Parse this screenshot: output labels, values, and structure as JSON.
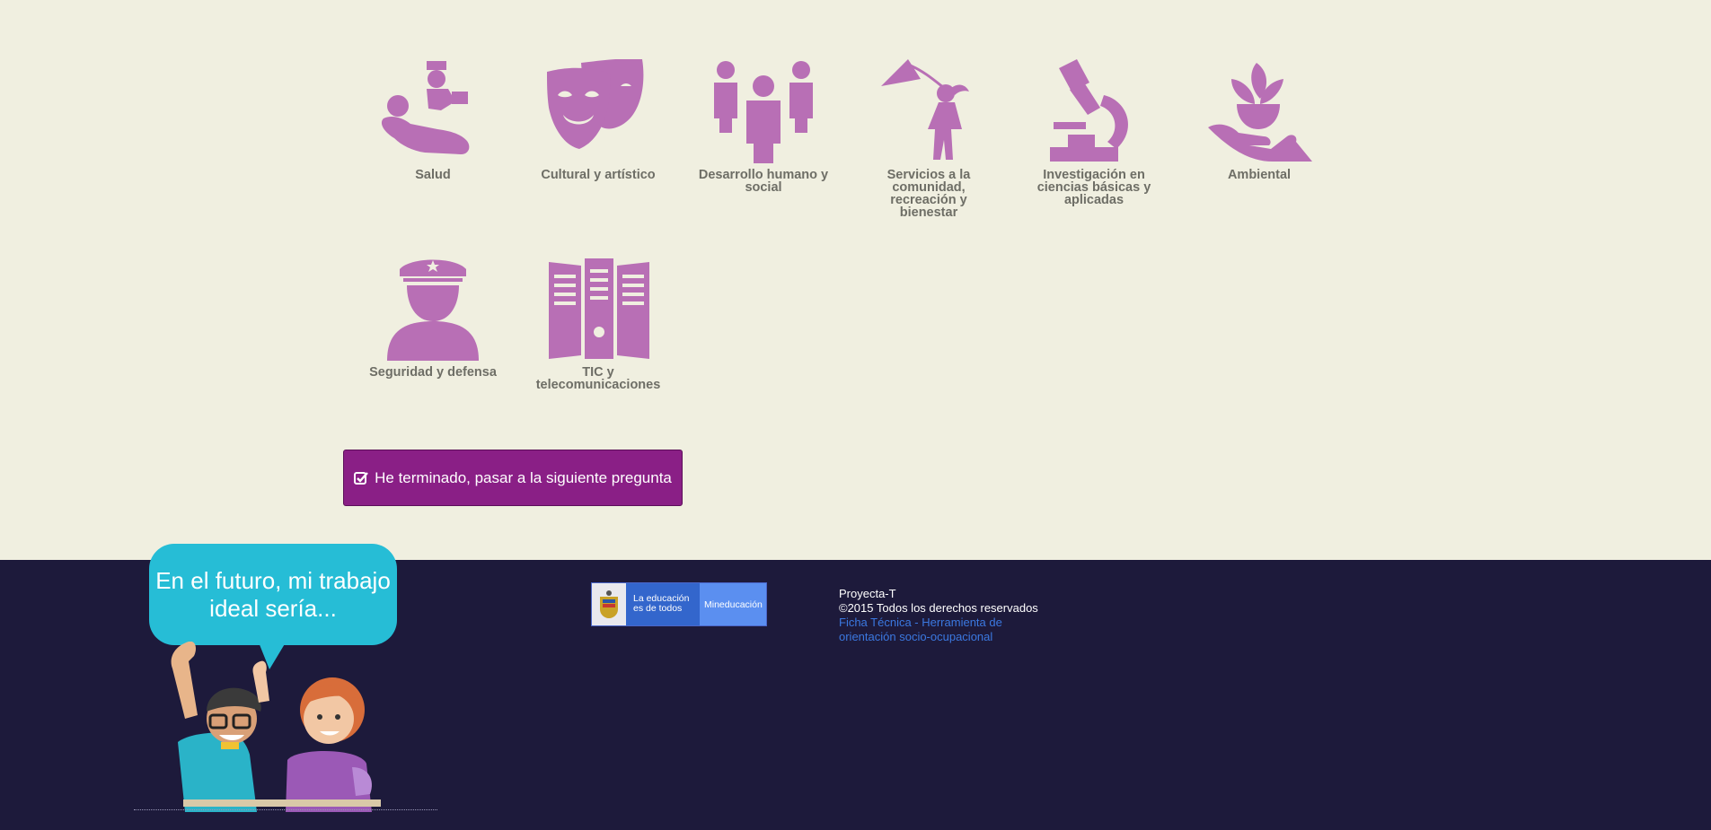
{
  "areas": [
    {
      "label": "Salud",
      "icon": "nurse-patient-icon"
    },
    {
      "label": "Cultural y artístico",
      "icon": "theater-masks-icon"
    },
    {
      "label": "Desarrollo humano y social",
      "icon": "people-group-icon"
    },
    {
      "label": "Servicios a la comunidad, recreación y bienestar",
      "icon": "girl-kite-icon"
    },
    {
      "label": "Investigación en ciencias básicas y aplicadas",
      "icon": "microscope-icon"
    },
    {
      "label": "Ambiental",
      "icon": "plant-hand-icon"
    },
    {
      "label": "Seguridad y defensa",
      "icon": "police-officer-icon"
    },
    {
      "label": "TIC y telecomunicaciones",
      "icon": "servers-icon"
    }
  ],
  "next_button": {
    "label": "He terminado, pasar a la siguiente pregunta"
  },
  "banner": {
    "bubble_text": "En el futuro, mi trabajo ideal sería..."
  },
  "gov_logo": {
    "line1": "La educación",
    "line2": "es de todos",
    "ministry": "Mineducación"
  },
  "footer": {
    "brand": "Proyecta-T",
    "copyright": "©2015 Todos los derechos reservados",
    "link": "Ficha Técnica - Herramienta de orientación socio-ocupacional"
  },
  "colors": {
    "icon": "#b86fb5",
    "button": "#8a1f86",
    "footer_bg": "#1d1a3b",
    "page_bg": "#f0efe0",
    "bubble": "#26bdd6",
    "link": "#3b78e0"
  }
}
